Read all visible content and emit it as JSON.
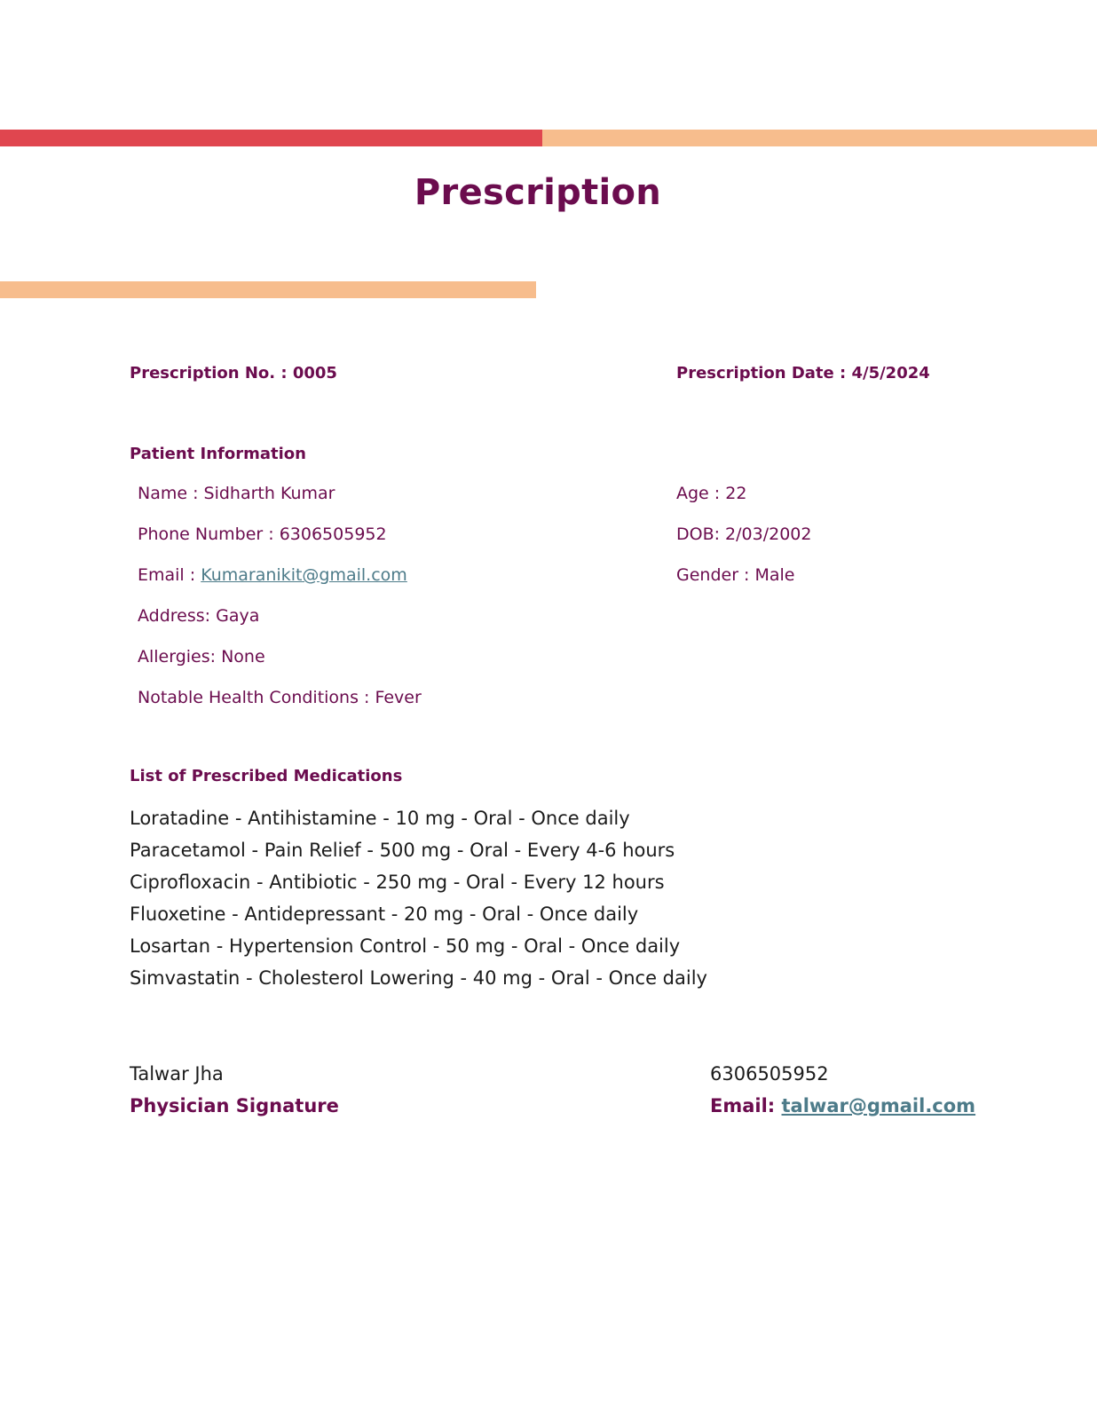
{
  "title": "Prescription",
  "prescription": {
    "number_label": "Prescription No. :",
    "number": "0005",
    "date_label": "Prescription Date :",
    "date": "4/5/2024"
  },
  "patient": {
    "section_title": "Patient Information",
    "name": "Name : Sidharth Kumar",
    "phone": "Phone Number : 6306505952",
    "email_label": "Email :",
    "email": "Kumaranikit@gmail.com",
    "address": "Address: Gaya",
    "allergies": "Allergies: None",
    "conditions": "Notable Health Conditions : Fever",
    "age": "Age : 22",
    "dob": "DOB: 2/03/2002",
    "gender": "Gender : Male"
  },
  "medications": {
    "section_title": "List of Prescribed Medications",
    "items": [
      "Loratadine - Antihistamine - 10 mg - Oral - Once daily",
      "Paracetamol - Pain Relief - 500 mg - Oral - Every 4-6 hours",
      "Ciprofloxacin - Antibiotic - 250 mg - Oral - Every 12 hours",
      "Fluoxetine - Antidepressant - 20 mg - Oral - Once daily",
      "Losartan - Hypertension Control - 50 mg - Oral - Once daily",
      "Simvastatin - Cholesterol Lowering - 40 mg - Oral - Once daily"
    ]
  },
  "physician": {
    "name": "Talwar Jha",
    "signature_label": "Physician Signature",
    "phone": "6306505952",
    "email_label": "Email:",
    "email": "talwar@gmail.com"
  },
  "colors": {
    "accent_red": "#e0464f",
    "accent_peach": "#f7bd8d",
    "heading_plum": "#6b0c4e",
    "link_teal": "#4d7b89"
  }
}
